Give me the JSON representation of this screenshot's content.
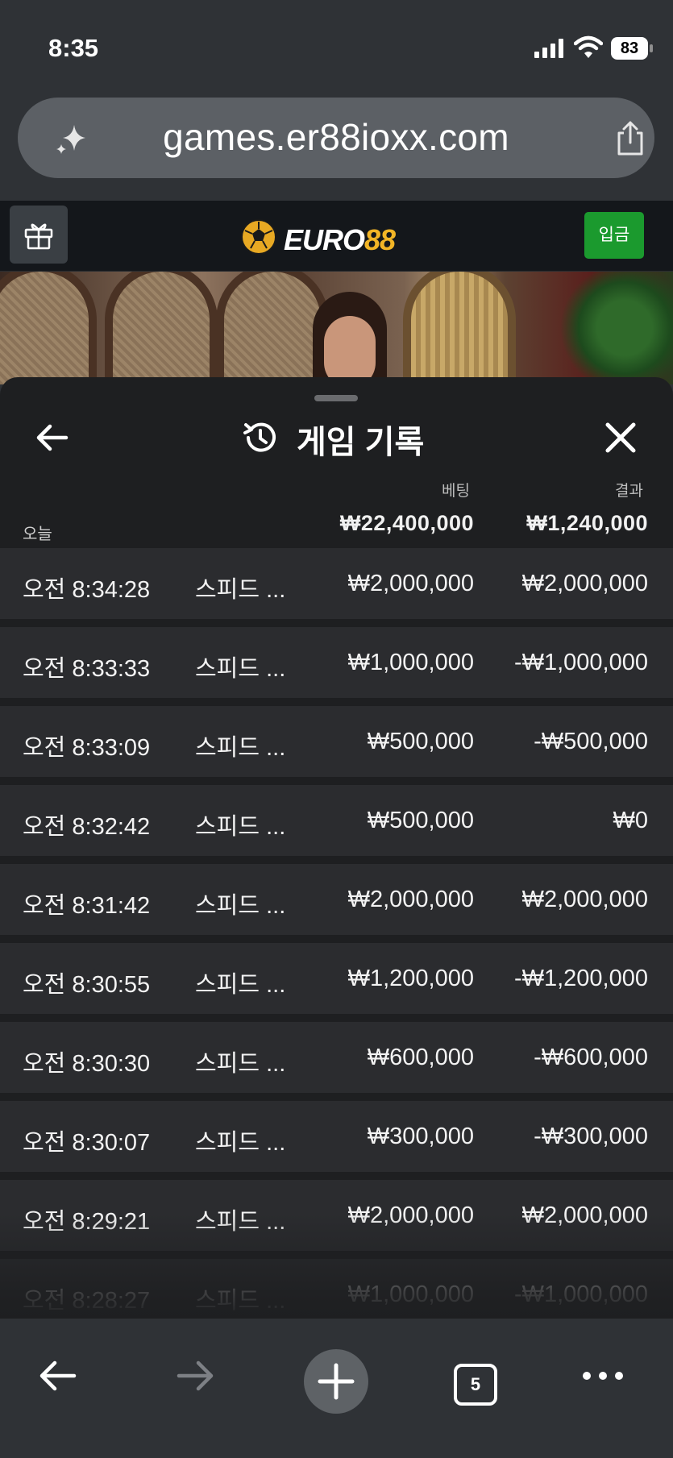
{
  "status_bar": {
    "time": "8:35",
    "battery": "83"
  },
  "browser": {
    "url": "games.er88ioxx.com",
    "tab_count": "5"
  },
  "site": {
    "logo_part1": "EURO",
    "logo_part2": "88",
    "deposit_label": "입금",
    "brand_colors": {
      "deposit": "#1b9a2e",
      "logo_accent": "#f2b526"
    }
  },
  "history": {
    "title": "게임 기록",
    "columns": {
      "bet": "베팅",
      "result": "결과"
    },
    "today_label": "오늘",
    "total_bet": "₩22,400,000",
    "total_result": "₩1,240,000",
    "rows": [
      {
        "time": "오전 8:34:28",
        "game": "스피드 ...",
        "bet": "₩2,000,000",
        "result": "₩2,000,000"
      },
      {
        "time": "오전 8:33:33",
        "game": "스피드 ...",
        "bet": "₩1,000,000",
        "result": "-₩1,000,000"
      },
      {
        "time": "오전 8:33:09",
        "game": "스피드 ...",
        "bet": "₩500,000",
        "result": "-₩500,000"
      },
      {
        "time": "오전 8:32:42",
        "game": "스피드 ...",
        "bet": "₩500,000",
        "result": "₩0"
      },
      {
        "time": "오전 8:31:42",
        "game": "스피드 ...",
        "bet": "₩2,000,000",
        "result": "₩2,000,000"
      },
      {
        "time": "오전 8:30:55",
        "game": "스피드 ...",
        "bet": "₩1,200,000",
        "result": "-₩1,200,000"
      },
      {
        "time": "오전 8:30:30",
        "game": "스피드 ...",
        "bet": "₩600,000",
        "result": "-₩600,000"
      },
      {
        "time": "오전 8:30:07",
        "game": "스피드 ...",
        "bet": "₩300,000",
        "result": "-₩300,000"
      },
      {
        "time": "오전 8:29:21",
        "game": "스피드 ...",
        "bet": "₩2,000,000",
        "result": "₩2,000,000"
      },
      {
        "time": "오전 8:28:27",
        "game": "스피드 ...",
        "bet": "₩1,000,000",
        "result": "-₩1,000,000"
      }
    ]
  }
}
